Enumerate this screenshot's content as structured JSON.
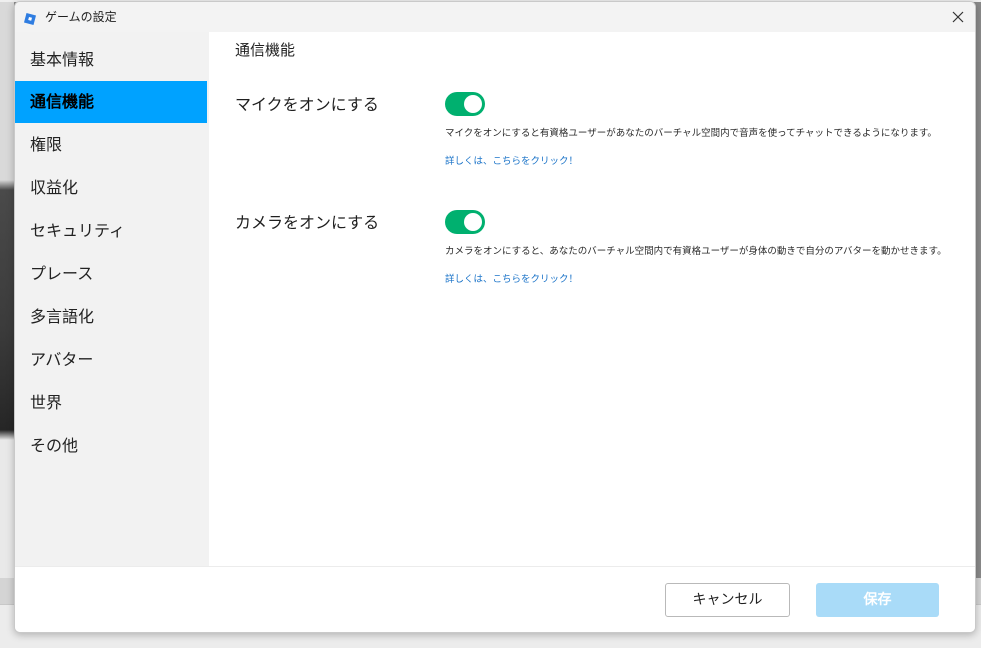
{
  "window": {
    "title": "ゲームの設定"
  },
  "sidebar": {
    "items": [
      {
        "label": "基本情報",
        "active": false
      },
      {
        "label": "通信機能",
        "active": true
      },
      {
        "label": "権限",
        "active": false
      },
      {
        "label": "収益化",
        "active": false
      },
      {
        "label": "セキュリティ",
        "active": false
      },
      {
        "label": "プレース",
        "active": false
      },
      {
        "label": "多言語化",
        "active": false
      },
      {
        "label": "アバター",
        "active": false
      },
      {
        "label": "世界",
        "active": false
      },
      {
        "label": "その他",
        "active": false
      }
    ]
  },
  "main": {
    "section_title": "通信機能",
    "settings": [
      {
        "label": "マイクをオンにする",
        "enabled": true,
        "description": "マイクをオンにすると有資格ユーザーがあなたのバーチャル空間内で音声を使ってチャットできるようになります。",
        "link": "詳しくは、こちらをクリック！"
      },
      {
        "label": "カメラをオンにする",
        "enabled": true,
        "description": "カメラをオンにすると、あなたのバーチャル空間内で有資格ユーザーが身体の動きで自分のアバターを動かせきます。",
        "link": "詳しくは、こちらをクリック！"
      }
    ]
  },
  "footer": {
    "cancel_label": "キャンセル",
    "save_label": "保存"
  },
  "colors": {
    "accent": "#00a2ff",
    "toggle_on": "#00b06f",
    "save_disabled": "#a9dbf8",
    "link": "#1a73c8"
  },
  "icons": {
    "app": "roblox-studio-logo-icon",
    "close": "close-icon"
  }
}
